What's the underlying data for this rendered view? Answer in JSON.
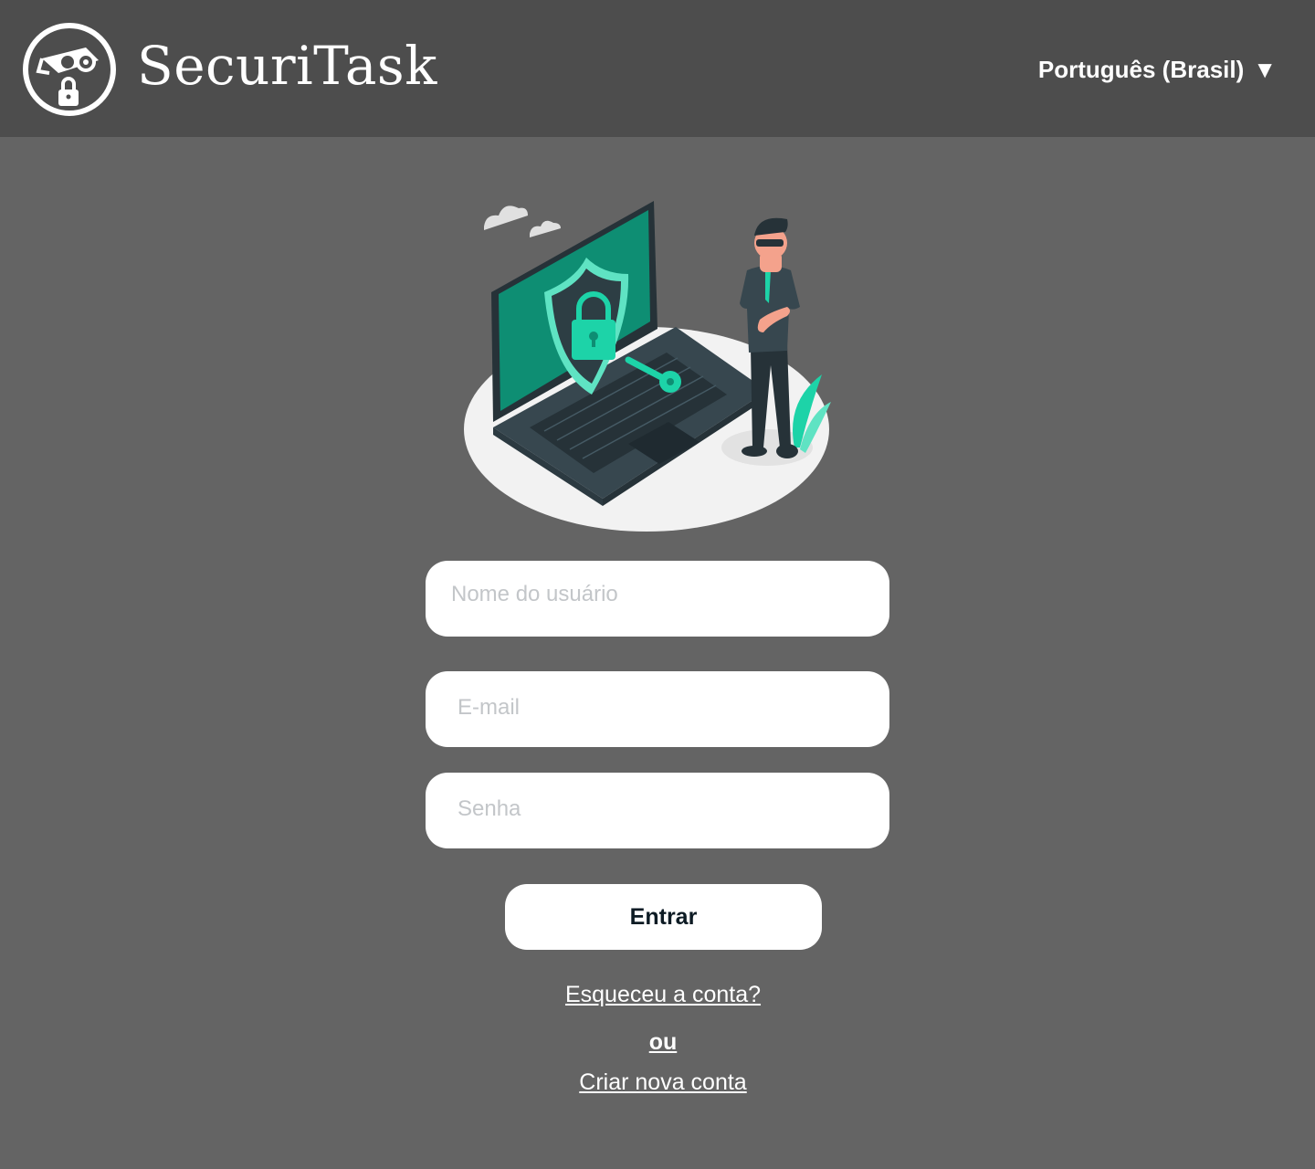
{
  "header": {
    "brand": "SecuriTask",
    "language": "Português (Brasil)",
    "language_caret": "▼",
    "logo_icon": "security-camera-lock-icon"
  },
  "illustration": {
    "icon": "laptop-security-guard-illustration",
    "colors": {
      "accent": "#1dd3a8",
      "screen": "#0e8e73",
      "laptop": "#37474f",
      "skin": "#f4a28c"
    }
  },
  "form": {
    "username_placeholder": "Nome do usuário",
    "email_placeholder": "E-mail",
    "password_placeholder": "Senha",
    "submit_label": "Entrar",
    "forgot_label": "Esqueceu a conta?",
    "or_label": "ou",
    "create_label": "Criar nova conta"
  },
  "colors": {
    "header_bg": "#4d4d4d",
    "page_bg": "#646464",
    "field_bg": "#ffffff"
  }
}
